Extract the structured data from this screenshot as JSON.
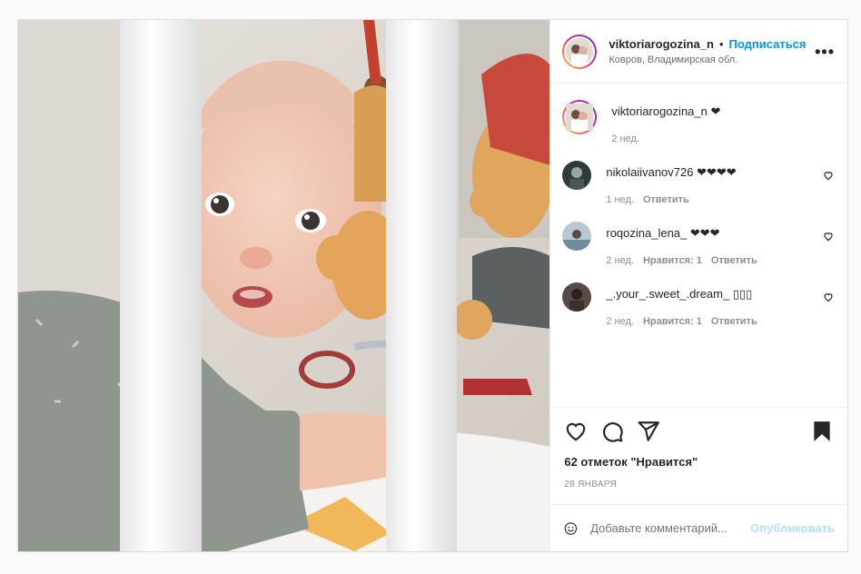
{
  "post": {
    "photo_icon": "baby-in-crib-photo",
    "header": {
      "username": "viktoriarogozina_n",
      "separator": "•",
      "follow_label": "Подписаться",
      "location": "Ковров, Владимирская обл.",
      "more_icon": "more-horizontal-icon",
      "more_label": "•••"
    },
    "caption": {
      "username": "viktoriarogozina_n",
      "text": "❤",
      "time": "2 нед."
    },
    "comments": [
      {
        "username": "nikolaiivanov726",
        "text": "❤❤❤❤",
        "time": "1 нед.",
        "likes": "",
        "reply": "Ответить"
      },
      {
        "username": "roqozina_lena_",
        "text": "❤❤❤",
        "time": "2 нед.",
        "likes": "Нравится: 1",
        "reply": "Ответить"
      },
      {
        "username": "_.your_.sweet_.dream_",
        "text": "▯▯▯",
        "time": "2 нед.",
        "likes": "Нравится: 1",
        "reply": "Ответить"
      }
    ],
    "actions": {
      "like_icon": "heart-icon",
      "comment_icon": "comment-icon",
      "share_icon": "paper-plane-icon",
      "save_icon": "bookmark-icon"
    },
    "likes_text": "62 отметок \"Нравится\"",
    "date_text": "28 ЯНВАРЯ",
    "add_comment": {
      "emoji_icon": "smile-icon",
      "placeholder": "Добавьте комментарий...",
      "publish_label": "Опубликовать"
    },
    "colors": {
      "accent": "#0095f6",
      "publish_disabled": "#b2dffc",
      "text": "#262626",
      "muted": "#8e8e8e"
    }
  }
}
